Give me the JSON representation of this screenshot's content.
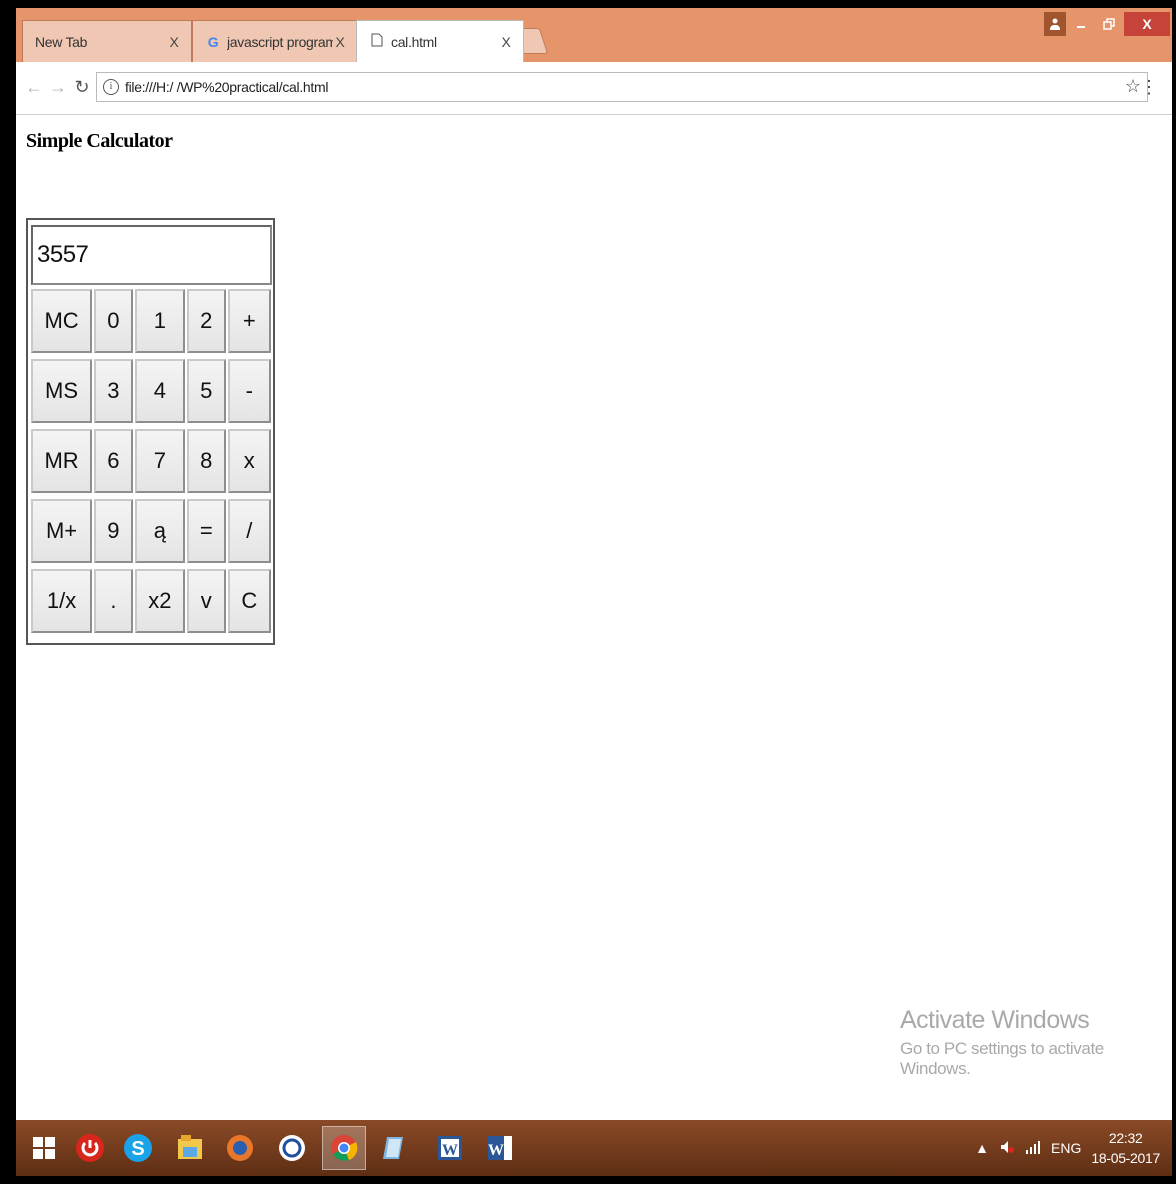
{
  "browser": {
    "tabs": [
      {
        "label": "New Tab",
        "close": "X"
      },
      {
        "label": "javascript program for ca",
        "close": "X"
      },
      {
        "label": "cal.html",
        "close": "X"
      }
    ],
    "url": "file:///H:/ /WP%20practical/cal.html",
    "window_controls": {
      "close": "X"
    }
  },
  "page": {
    "title": "Simple Calculator"
  },
  "calculator": {
    "display_value": "3557",
    "rows": [
      [
        "MC",
        "0",
        "1",
        "2",
        "+"
      ],
      [
        "MS",
        "3",
        "4",
        "5",
        "-"
      ],
      [
        "MR",
        "6",
        "7",
        "8",
        "x"
      ],
      [
        "M+",
        "9",
        "ą",
        "=",
        "/"
      ],
      [
        "1/x",
        ".",
        "x2",
        "v",
        "C"
      ]
    ]
  },
  "watermark": {
    "title": "Activate Windows",
    "subtitle": "Go to PC settings to activate Windows."
  },
  "taskbar": {
    "icons": [
      "windows-icon",
      "power-icon",
      "skype-icon",
      "file-explorer-icon",
      "firefox-icon",
      "app-icon",
      "chrome-icon",
      "notes-icon",
      "word-icon",
      "word-icon"
    ],
    "tray": {
      "language": "ENG",
      "time": "22:32",
      "date": "18-05-2017"
    }
  },
  "colors": {
    "tabstrip": "#e6956a",
    "taskbar": "#6e3a1c",
    "close_button": "#c6433a"
  }
}
